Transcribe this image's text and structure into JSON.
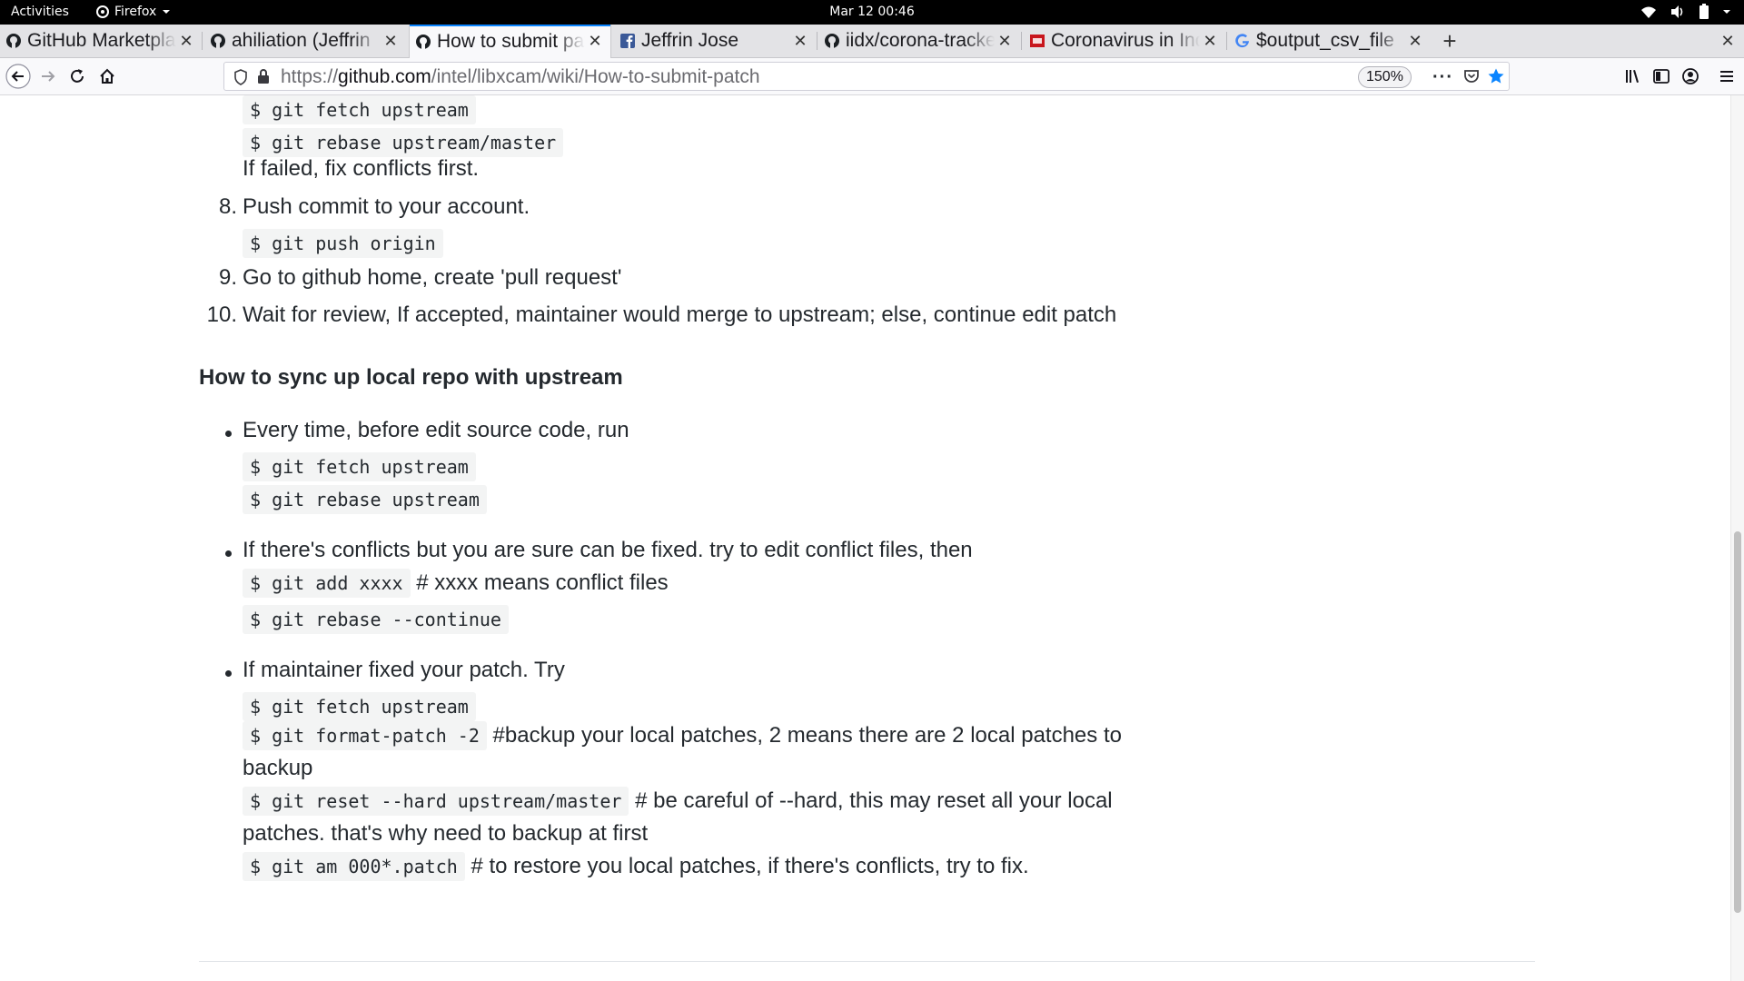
{
  "system_bar": {
    "activities": "Activities",
    "app_name": "Firefox",
    "clock": "Mar 12  00:46"
  },
  "tabs": [
    {
      "title": "GitHub Marketplace",
      "icon": "github-icon",
      "active": false
    },
    {
      "title": "ahiliation (Jeffrin",
      "icon": "github-icon",
      "active": false
    },
    {
      "title": "How to submit patch",
      "icon": "github-icon",
      "active": true
    },
    {
      "title": "Jeffrin Jose",
      "icon": "facebook-icon",
      "active": false
    },
    {
      "title": "iidx/corona-tracker",
      "icon": "github-icon",
      "active": false
    },
    {
      "title": "Coronavirus in India",
      "icon": "toi-icon",
      "active": false
    },
    {
      "title": "$output_csv_file",
      "icon": "google-icon",
      "active": false
    }
  ],
  "navbar": {
    "url_prefix": "https://",
    "url_domain": "github.com",
    "url_path": "/intel/libxcam/wiki/How-to-submit-patch",
    "zoom": "150%"
  },
  "content": {
    "code_fetch_1": "$ git fetch upstream",
    "code_rebase_master": "$ git rebase upstream/master",
    "text_if_failed": "If failed, fix conflicts first.",
    "step8_num": "8.",
    "step8_text": "Push commit to your account.",
    "code_push": "$ git push origin",
    "step9_num": "9.",
    "step9_text": "Go to github home, create 'pull request'",
    "step10_num": "10.",
    "step10_text": "Wait for review, If accepted, maintainer would merge to upstream; else, continue edit patch",
    "heading_sync": "How to sync up local repo with upstream",
    "bullet1_text": "Every time, before edit source code, run",
    "code_fetch_2": "$ git fetch upstream",
    "code_rebase_upstream": "$ git rebase upstream",
    "bullet2_text": "If there's conflicts but you are sure can be fixed. try to edit conflict files, then",
    "code_add": "$ git add xxxx",
    "text_add_comment": " # xxxx means conflict files",
    "code_rebase_continue": "$ git rebase --continue",
    "bullet3_text": "If maintainer fixed your patch. Try",
    "code_fetch_3": "$ git fetch upstream",
    "code_format_patch": "$ git format-patch -2",
    "text_format_comment": " #backup your local patches, 2 means there are 2 local patches to",
    "text_backup": "backup",
    "code_reset": "$ git reset --hard upstream/master",
    "text_reset_comment": " # be careful of --hard, this may reset all your local",
    "text_reset_cont": "patches. that's why need to backup at first",
    "code_am": "$ git am 000*.patch",
    "text_am_comment": " # to restore you local patches, if there's conflicts, try to fix."
  }
}
